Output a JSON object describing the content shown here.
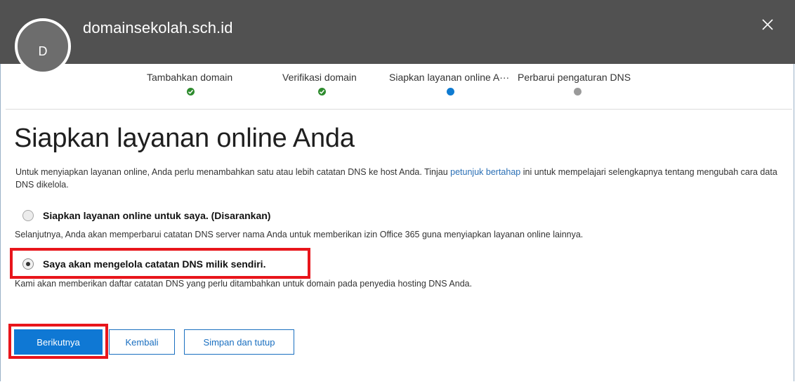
{
  "header": {
    "avatar_letter": "D",
    "title": "domainsekolah.sch.id",
    "close_glyph": "×"
  },
  "stepper": {
    "steps": [
      {
        "label": "Tambahkan domain",
        "status": "done"
      },
      {
        "label": "Verifikasi domain",
        "status": "done"
      },
      {
        "label": "Siapkan layanan online A···",
        "status": "active"
      },
      {
        "label": "Perbarui pengaturan DNS",
        "status": "pending"
      }
    ]
  },
  "main": {
    "title": "Siapkan layanan online Anda",
    "description_before": "Untuk menyiapkan layanan online, Anda perlu menambahkan satu atau lebih catatan DNS ke host Anda. Tinjau ",
    "description_link": "petunjuk bertahap",
    "description_after": " ini untuk mempelajari selengkapnya tentang mengubah cara data DNS dikelola.",
    "options": [
      {
        "label": "Siapkan layanan online untuk saya. (Disarankan)",
        "description": "Selanjutnya, Anda akan memperbarui catatan DNS server nama Anda untuk memberikan izin Office 365 guna menyiapkan layanan online lainnya.",
        "checked": false
      },
      {
        "label": "Saya akan mengelola catatan DNS milik sendiri.",
        "description": "Kami akan memberikan daftar catatan DNS yang perlu ditambahkan untuk domain pada penyedia hosting DNS Anda.",
        "checked": true
      }
    ]
  },
  "buttons": {
    "next": "Berikutnya",
    "back": "Kembali",
    "save_close": "Simpan dan tutup"
  },
  "colors": {
    "header_bg": "#515151",
    "accent": "#0f78d4",
    "done": "#2e8b2e",
    "pending": "#9a9a9a",
    "highlight": "#e8151b"
  }
}
